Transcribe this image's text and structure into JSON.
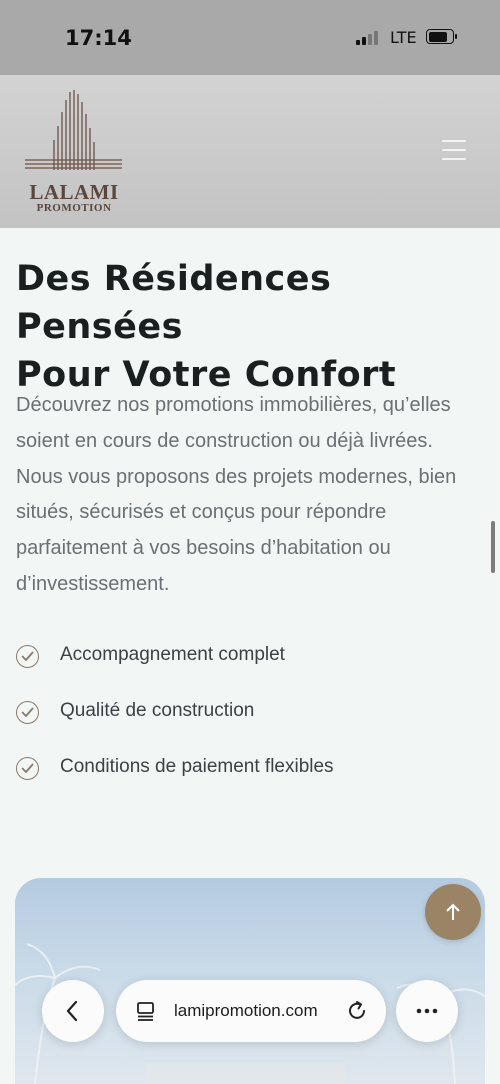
{
  "status_bar": {
    "time": "17:14",
    "network": "LTE",
    "icons": [
      "signal-icon",
      "battery-icon"
    ]
  },
  "header": {
    "logo_name": "LALAMI",
    "logo_sub": "PROMOTION",
    "menu_icon": "hamburger-menu-icon"
  },
  "main": {
    "title_line1": "Des Résidences Pensées",
    "title_line2": "Pour Votre Confort",
    "description": "Découvrez nos promotions immobilières, qu’elles soient en cours de construction ou déjà livrées. Nous vous proposons des projets modernes, bien situés, sécurisés et conçus pour répondre parfaitement à vos besoins d’habitation ou d’investissement.",
    "features": [
      {
        "label": "Accompagnement complet",
        "icon": "check-circle-icon"
      },
      {
        "label": "Qualité de construction",
        "icon": "check-circle-icon"
      },
      {
        "label": "Conditions de paiement flexibles",
        "icon": "check-circle-icon"
      }
    ]
  },
  "scroll_top": {
    "icon": "arrow-up-icon"
  },
  "browser_bar": {
    "url": "lamipromotion.com",
    "back_icon": "back-chevron-icon",
    "tabs_icon": "tabs-icon",
    "reload_icon": "reload-icon",
    "more_icon": "more-dots-icon"
  },
  "colors": {
    "accent": "#9b8366",
    "logo": "#5a463c",
    "heading": "#1a1f1f",
    "body_text": "#6c6f73",
    "background": "#f2f6f5"
  }
}
